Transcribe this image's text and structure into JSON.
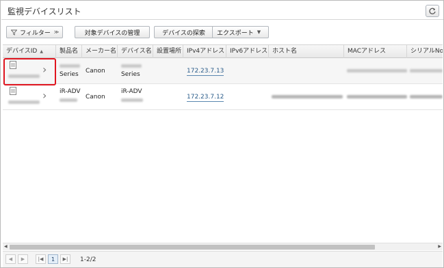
{
  "header": {
    "title": "監視デバイスリスト"
  },
  "icons": {
    "refresh": "refresh-icon",
    "filter": "filter-funnel-icon",
    "document": "document-icon",
    "chevron": "chevron-right-icon"
  },
  "toolbar": {
    "filter_label": "フィルター",
    "filter_caret": "≫",
    "manage_label": "対象デバイスの管理",
    "search_label": "デバイスの探索",
    "export_label": "エクスポート",
    "export_caret": "▼"
  },
  "table": {
    "columns": [
      "デバイスID",
      "製品名",
      "メーカー名",
      "デバイス名",
      "設置場所",
      "IPv4アドレス",
      "IPv6アドレス",
      "ホスト名",
      "MACアドレス",
      "シリアルNo."
    ],
    "sort_indicator": "▲",
    "rows": [
      {
        "product": "Series",
        "maker": "Canon",
        "device_name": "Series",
        "ipv4": "172.23.7.13"
      },
      {
        "product": "iR-ADV",
        "maker": "Canon",
        "device_name": "iR-ADV",
        "ipv4": "172.23.7.12"
      }
    ]
  },
  "pager": {
    "current_page": "1",
    "range_text": "1-2/2"
  },
  "colors": {
    "highlight": "#e0141e",
    "link": "#2a5c8a"
  }
}
